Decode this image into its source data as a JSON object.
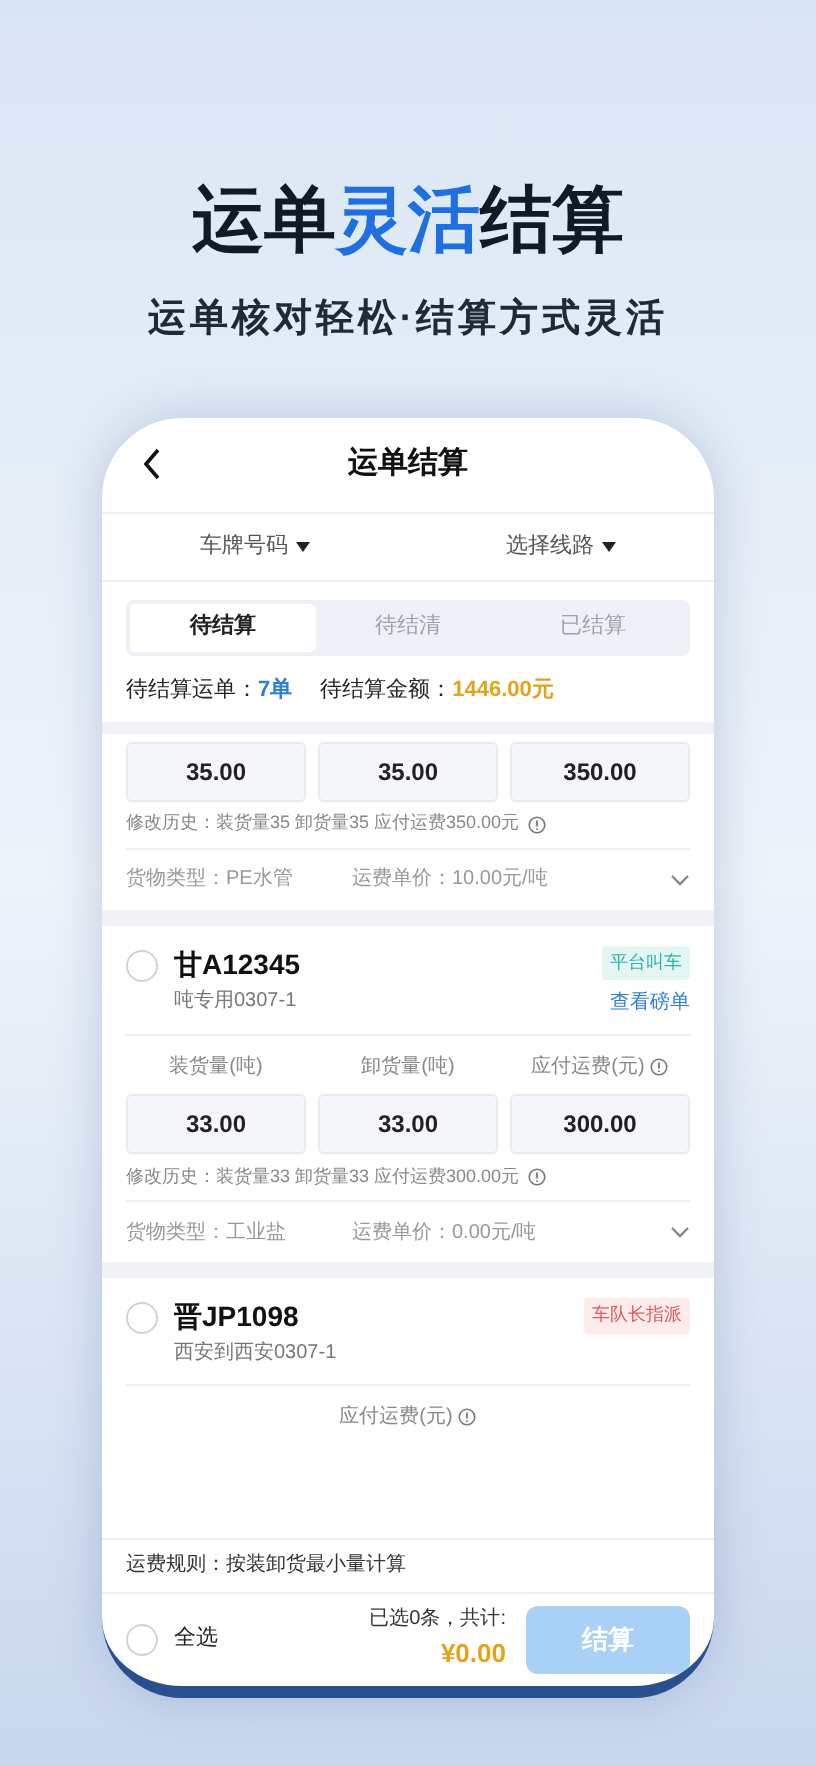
{
  "headline": [
    {
      "text": "运单",
      "accent": false
    },
    {
      "text": "灵活",
      "accent": true
    },
    {
      "text": "结算",
      "accent": false
    }
  ],
  "subtitle": "运单核对轻松·结算方式灵活",
  "screen": {
    "title": "运单结算",
    "filters": [
      "车牌号码",
      "选择线路"
    ],
    "tabs": [
      {
        "label": "待结算",
        "selected": true
      },
      {
        "label": "待结清",
        "selected": false
      },
      {
        "label": "已结算",
        "selected": false
      }
    ],
    "summary": [
      {
        "label": "待结算运单：",
        "value": "7单",
        "kind": "count"
      },
      {
        "label": "待结算金额：",
        "value": "1446.00元",
        "kind": "amount"
      }
    ],
    "orders": [
      {
        "values": [
          "35.00",
          "35.00",
          "350.00"
        ],
        "history": "修改历史：装货量35 卸货量35 应付运费350.00元",
        "cargo": "货物类型：PE水管",
        "price": "运费单价：10.00元/吨"
      },
      {
        "plate": "甘A12345",
        "route": "吨专用0307-1",
        "checked": false,
        "tag": {
          "text": "平台叫车",
          "kind": "platform"
        },
        "link": "查看磅单",
        "labels": [
          "装货量(吨)",
          "卸货量(吨)",
          "应付运费(元)"
        ],
        "values": [
          "33.00",
          "33.00",
          "300.00"
        ],
        "history": "修改历史：装货量33 卸货量33 应付运费300.00元",
        "cargo": "货物类型：工业盐",
        "price": "运费单价：0.00元/吨"
      },
      {
        "plate": "晋JP1098",
        "route": "西安到西安0307-1",
        "checked": false,
        "tag": {
          "text": "车队长指派",
          "kind": "captain"
        },
        "partial_label": "应付运费(元)"
      }
    ],
    "rule": "运费规则：按装卸货最小量计算",
    "footer": {
      "select_all": "全选",
      "checked": false,
      "selected_text": "已选0条，共计:",
      "total": "¥0.00",
      "button": "结算",
      "disabled": true
    }
  }
}
